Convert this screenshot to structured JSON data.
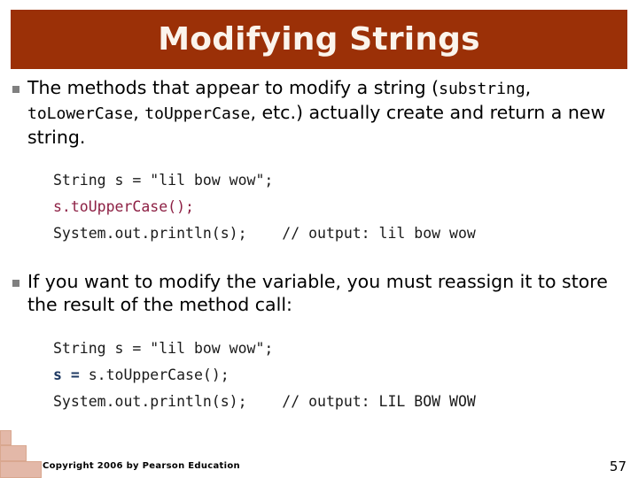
{
  "slide": {
    "title": "Modifying Strings",
    "bar_color": "#9B3007",
    "title_color": "#FBF4EC"
  },
  "bullets": [
    {
      "marker": "square-bullet",
      "segments": [
        {
          "text": "The methods that appear to modify a string (",
          "style": "normal"
        },
        {
          "text": "substring",
          "style": "mono"
        },
        {
          "text": ", ",
          "style": "normal"
        },
        {
          "text": "toLowerCase",
          "style": "mono"
        },
        {
          "text": ", ",
          "style": "normal"
        },
        {
          "text": "toUpperCase",
          "style": "mono"
        },
        {
          "text": ", etc.) actually create and return a new string.",
          "style": "normal"
        }
      ]
    },
    {
      "marker": "square-bullet",
      "segments": [
        {
          "text": "If you want to modify the variable, you must reassign it to store the result of the method call:",
          "style": "normal"
        }
      ]
    }
  ],
  "code_blocks": [
    {
      "id": "code-1",
      "lines": [
        [
          {
            "text": "String s = \"lil bow wow\";",
            "color": "default"
          }
        ],
        [
          {
            "text": "s.toUpperCase();",
            "color": "red"
          }
        ],
        [
          {
            "text": "System.out.println(s);    // output: lil bow wow",
            "color": "default"
          }
        ]
      ]
    },
    {
      "id": "code-2",
      "lines": [
        [
          {
            "text": "String s = \"lil bow wow\";",
            "color": "default"
          }
        ],
        [
          {
            "text": "s = ",
            "color": "blue"
          },
          {
            "text": "s.toUpperCase();",
            "color": "default"
          }
        ],
        [
          {
            "text": "System.out.println(s);    // output: LIL BOW WOW",
            "color": "default"
          }
        ]
      ]
    }
  ],
  "colors": {
    "code_red": "#8D2044",
    "code_blue": "#1F3A63",
    "bullet_marker": "#808080",
    "deco_block": "#E3B8A8"
  },
  "footer": {
    "copyright": "Copyright 2006 by Pearson Education",
    "page_number": "57"
  }
}
